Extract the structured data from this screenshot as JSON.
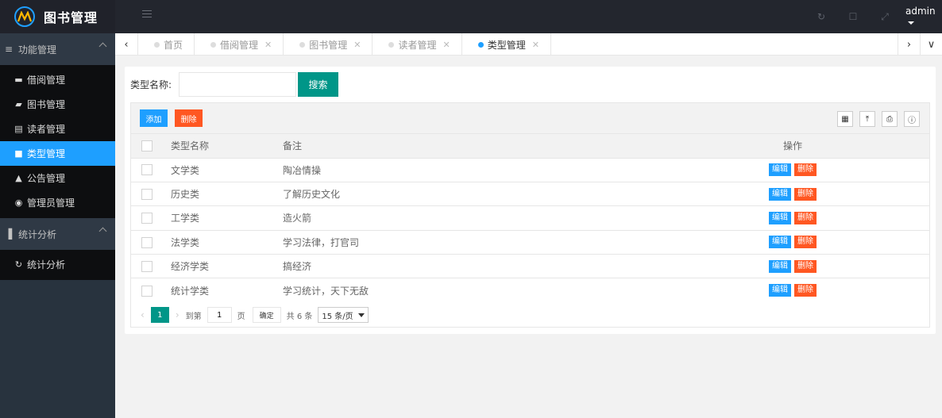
{
  "app": {
    "title": "图书管理",
    "user": "admin"
  },
  "sidebar": {
    "groups": [
      {
        "label": "功能管理",
        "items": [
          {
            "label": "借阅管理",
            "icon": "window-icon",
            "active": false
          },
          {
            "label": "图书管理",
            "icon": "book-icon",
            "active": false
          },
          {
            "label": "读者管理",
            "icon": "card-icon",
            "active": false
          },
          {
            "label": "类型管理",
            "icon": "file-icon",
            "active": true
          },
          {
            "label": "公告管理",
            "icon": "bell-icon",
            "active": false
          },
          {
            "label": "管理员管理",
            "icon": "user-circle-icon",
            "active": false
          }
        ]
      },
      {
        "label": "统计分析",
        "items": [
          {
            "label": "统计分析",
            "icon": "refresh-icon",
            "active": false
          }
        ]
      }
    ]
  },
  "tabs": [
    {
      "label": "首页",
      "closable": false,
      "active": false
    },
    {
      "label": "借阅管理",
      "closable": true,
      "active": false
    },
    {
      "label": "图书管理",
      "closable": true,
      "active": false
    },
    {
      "label": "读者管理",
      "closable": true,
      "active": false
    },
    {
      "label": "类型管理",
      "closable": true,
      "active": true
    }
  ],
  "search": {
    "label": "类型名称:",
    "value": "",
    "button": "搜索"
  },
  "toolbar": {
    "add": "添加",
    "delete": "删除"
  },
  "table": {
    "columns": [
      "类型名称",
      "备注",
      "操作"
    ],
    "rows": [
      {
        "name": "文学类",
        "note": "陶冶情操"
      },
      {
        "name": "历史类",
        "note": "了解历史文化"
      },
      {
        "name": "工学类",
        "note": "造火箭"
      },
      {
        "name": "法学类",
        "note": "学习法律，打官司"
      },
      {
        "name": "经济学类",
        "note": "搞经济"
      },
      {
        "name": "统计学类",
        "note": "学习统计，天下无敌"
      }
    ],
    "row_actions": {
      "edit": "编辑",
      "delete": "删除"
    }
  },
  "pager": {
    "current": "1",
    "goto_label": "到第",
    "goto_value": "1",
    "page_unit": "页",
    "confirm": "确定",
    "total": "共 6 条",
    "page_size": "15 条/页"
  },
  "colors": {
    "accent": "#1e9fff",
    "primary": "#009688",
    "danger": "#ff5722",
    "header": "#23262e",
    "sidebar": "#28333e"
  }
}
